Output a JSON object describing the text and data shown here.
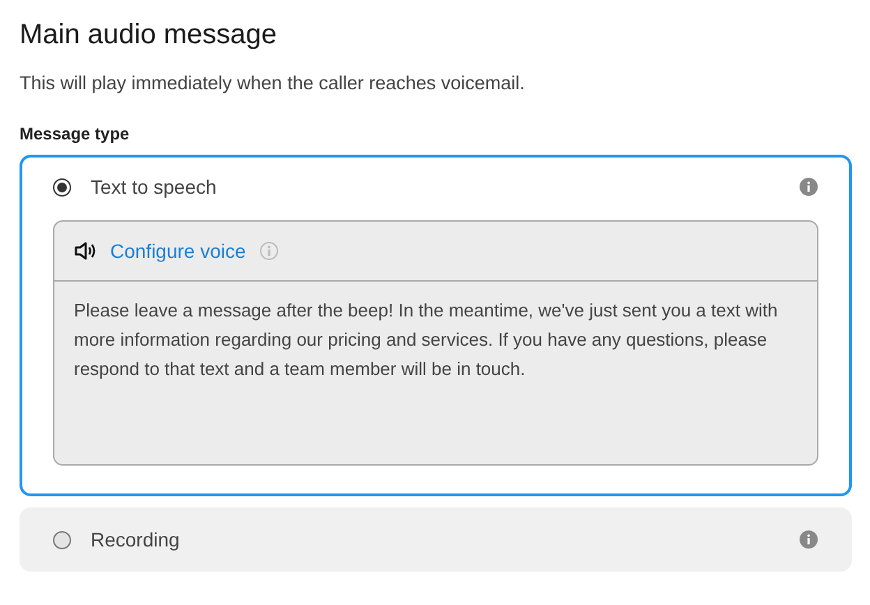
{
  "title": "Main audio message",
  "description": "This will play immediately when the caller reaches voicemail.",
  "field_label": "Message type",
  "options": [
    {
      "label": "Text to speech",
      "selected": true,
      "voice_link": "Configure voice",
      "message": "Please leave a message after the beep! In the meantime, we've just sent you a text with more information regarding our pricing and services. If you have any questions, please respond to that text and a team member will be in touch."
    },
    {
      "label": "Recording",
      "selected": false
    }
  ]
}
